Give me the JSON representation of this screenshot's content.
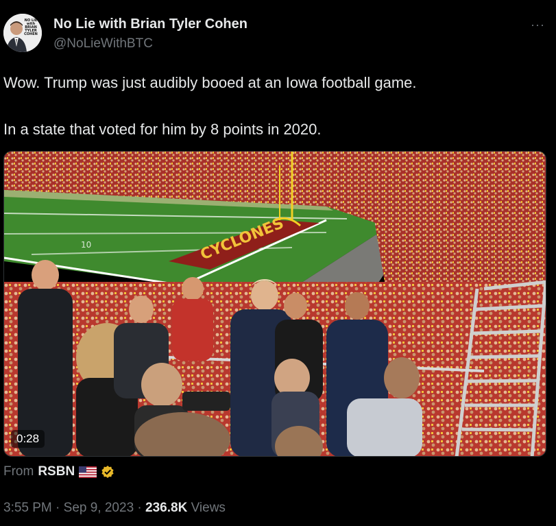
{
  "author": {
    "name": "No Lie with Brian Tyler Cohen",
    "handle": "@NoLieWithBTC",
    "avatar_logo": "NO LIE with BRIAN TYLER COHEN"
  },
  "more_label": "···",
  "tweet": {
    "line1": "Wow. Trump was just audibly booed at an Iowa football game.",
    "line2": "In a state that voted for him by 8 points in 2020."
  },
  "media": {
    "duration": "0:28",
    "yard_marker": "10",
    "endzone_text": "CYCLONES"
  },
  "source": {
    "prefix": "From",
    "name": "RSBN",
    "flag_icon": "us-flag-icon",
    "badge_icon": "verified-gold-badge-icon"
  },
  "meta": {
    "time": "3:55 PM",
    "sep1": "·",
    "date": "Sep 9, 2023",
    "sep2": "·",
    "views_count": "236.8K",
    "views_label": "Views"
  },
  "colors": {
    "background": "#000000",
    "text": "#e7e9ea",
    "muted": "#71767b",
    "verified_gold": "#e8b829",
    "field_green": "#3f8a2e",
    "crowd_red": "#b3342a"
  }
}
